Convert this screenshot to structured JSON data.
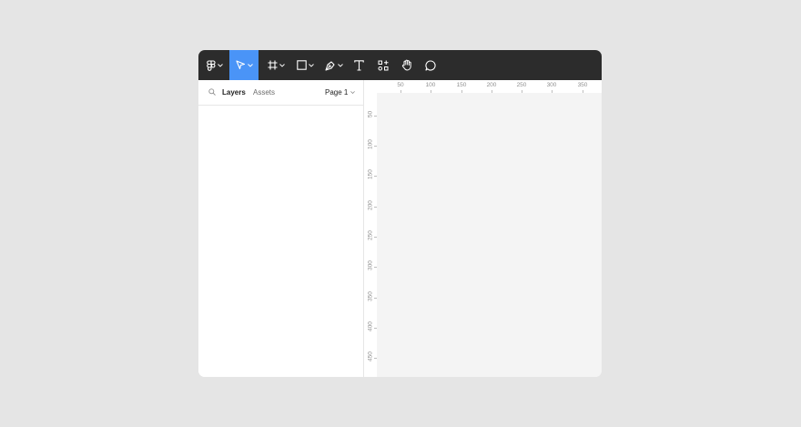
{
  "toolbar": {
    "tools": [
      {
        "name": "main-menu",
        "icon": "figma-logo-icon",
        "has_menu": true,
        "active": false
      },
      {
        "name": "move-tool",
        "icon": "cursor-icon",
        "has_menu": true,
        "active": true
      },
      {
        "name": "frame-tool",
        "icon": "frame-icon",
        "has_menu": true,
        "active": false
      },
      {
        "name": "shape-tool",
        "icon": "rectangle-icon",
        "has_menu": true,
        "active": false
      },
      {
        "name": "pen-tool",
        "icon": "pen-icon",
        "has_menu": true,
        "active": false
      },
      {
        "name": "text-tool",
        "icon": "text-icon",
        "has_menu": false,
        "active": false
      },
      {
        "name": "resources-tool",
        "icon": "resources-icon",
        "has_menu": false,
        "active": false
      },
      {
        "name": "hand-tool",
        "icon": "hand-icon",
        "has_menu": false,
        "active": false
      },
      {
        "name": "comment-tool",
        "icon": "comment-icon",
        "has_menu": false,
        "active": false
      }
    ],
    "active_color": "#4a94f7",
    "background": "#2c2c2c"
  },
  "sidebar": {
    "search_icon": "search-icon",
    "tabs": [
      {
        "label": "Layers",
        "active": true
      },
      {
        "label": "Assets",
        "active": false
      }
    ],
    "page_label": "Page 1",
    "page_icon": "chevron-down-icon"
  },
  "rulers": {
    "x_labels": [
      "50",
      "100",
      "150",
      "200",
      "250",
      "300",
      "350"
    ],
    "y_labels": [
      "50",
      "100",
      "150",
      "200",
      "250",
      "300",
      "350",
      "400",
      "450"
    ]
  }
}
